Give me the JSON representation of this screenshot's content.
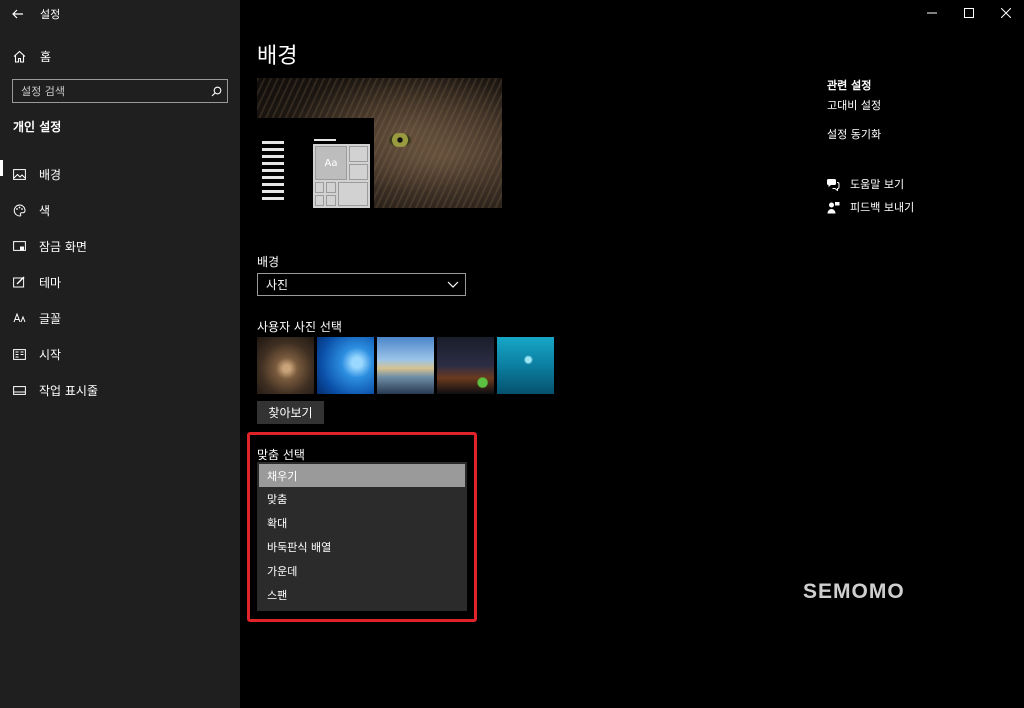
{
  "window": {
    "app_title": "설정",
    "icons": {
      "back": "arrow-left-icon",
      "minimize": "minimize-icon",
      "maximize": "maximize-icon",
      "close": "close-icon"
    }
  },
  "sidebar": {
    "home_label": "홈",
    "search_placeholder": "설정 검색",
    "section_title": "개인 설정",
    "items": [
      {
        "label": "배경",
        "icon": "image-icon",
        "active": true
      },
      {
        "label": "색",
        "icon": "palette-icon",
        "active": false
      },
      {
        "label": "잠금 화면",
        "icon": "lock-screen-icon",
        "active": false
      },
      {
        "label": "테마",
        "icon": "theme-icon",
        "active": false
      },
      {
        "label": "글꼴",
        "icon": "font-icon",
        "active": false
      },
      {
        "label": "시작",
        "icon": "start-icon",
        "active": false
      },
      {
        "label": "작업 표시줄",
        "icon": "taskbar-icon",
        "active": false
      }
    ]
  },
  "main": {
    "page_title": "배경",
    "preview_tile_text": "Aa",
    "background_label": "배경",
    "background_value": "사진",
    "photo_picker_label": "사용자 사진 선택",
    "browse_label": "찾아보기",
    "fit_label": "맞춤 선택",
    "fit_options": [
      "채우기",
      "맞춤",
      "확대",
      "바둑판식 배열",
      "가운데",
      "스팬"
    ],
    "fit_selected": "채우기"
  },
  "related": {
    "title": "관련 설정",
    "links": [
      "고대비 설정",
      "설정 동기화"
    ],
    "help_label": "도움말 보기",
    "feedback_label": "피드백 보내기"
  },
  "watermark": "SEMOMO",
  "colors": {
    "highlight": "#e0232a",
    "sidebar_bg": "#1f1f1f",
    "selected_option": "#9a9a9a"
  }
}
